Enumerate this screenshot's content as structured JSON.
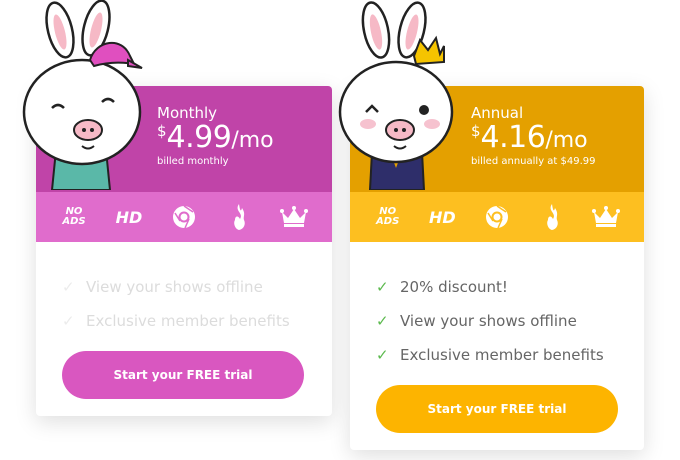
{
  "plans": {
    "monthly": {
      "title": "Monthly",
      "currency": "$",
      "amount": "4.99",
      "period": "/mo",
      "billing": "billed monthly",
      "features": [
        "View your shows offline",
        "Exclusive member benefits"
      ],
      "cta": "Start your FREE trial",
      "header_color": "#c044a8",
      "strip_color": "#e06ccc",
      "button_color": "#d957c0"
    },
    "annual": {
      "title": "Annual",
      "currency": "$",
      "amount": "4.16",
      "period": "/mo",
      "billing": "billed annually at $49.99",
      "features": [
        "20% discount!",
        "View your shows offline",
        "Exclusive member benefits"
      ],
      "cta": "Start your FREE trial",
      "header_color": "#e4a000",
      "strip_color": "#fdbf20",
      "button_color": "#fdb400"
    }
  },
  "perks": {
    "noads_line1": "NO",
    "noads_line2": "ADS",
    "hd": "HD",
    "icons": [
      "no-ads-icon",
      "hd-icon",
      "chrome-icon",
      "flame-icon",
      "crown-icon"
    ]
  }
}
